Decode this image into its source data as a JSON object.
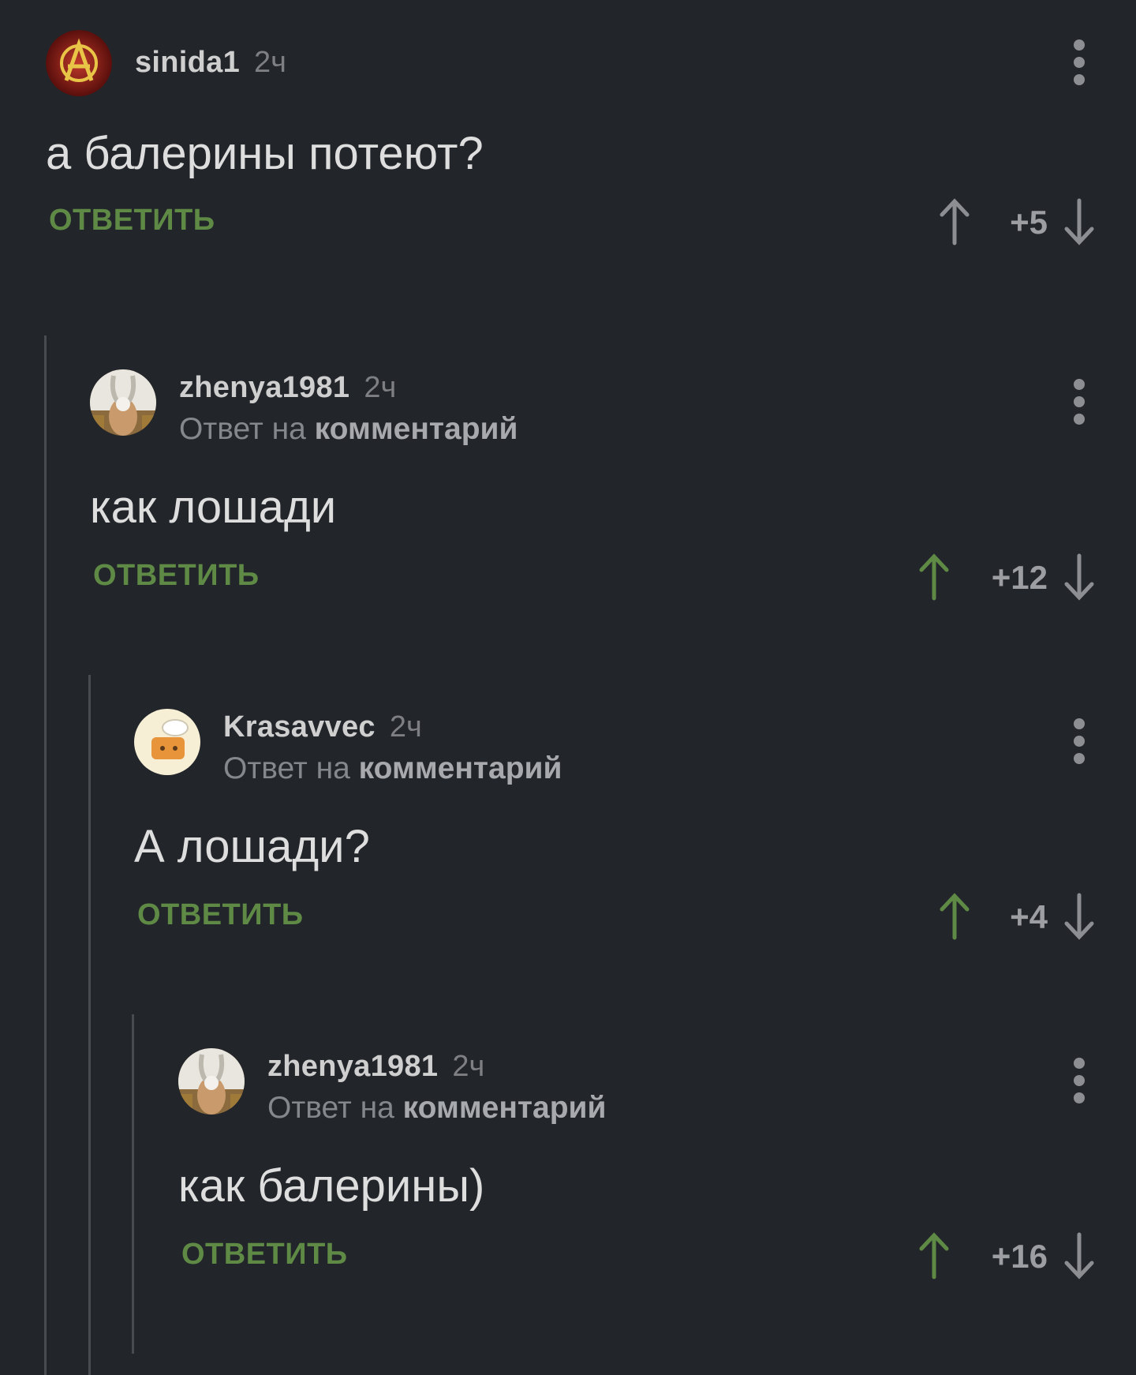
{
  "comments": [
    {
      "username": "sinida1",
      "time": "2ч",
      "avatar_icon": "anarchy-icon",
      "reply_to_prefix": "",
      "reply_to_link": "",
      "text": "а балерины потеют?",
      "reply_label": "ОТВЕТИТЬ",
      "score": "+5",
      "upvoted": false
    },
    {
      "username": "zhenya1981",
      "time": "2ч",
      "avatar_icon": "rabbit-icon",
      "reply_to_prefix": "Ответ на",
      "reply_to_link": "комментарий",
      "text": "как лошади",
      "reply_label": "ОТВЕТИТЬ",
      "score": "+12",
      "upvoted": true
    },
    {
      "username": "Krasavvec",
      "time": "2ч",
      "avatar_icon": "cartoon-face-icon",
      "reply_to_prefix": "Ответ на",
      "reply_to_link": "комментарий",
      "text": "А лошади?",
      "reply_label": "ОТВЕТИТЬ",
      "score": "+4",
      "upvoted": true
    },
    {
      "username": "zhenya1981",
      "time": "2ч",
      "avatar_icon": "rabbit-icon",
      "reply_to_prefix": "Ответ на",
      "reply_to_link": "комментарий",
      "text": "как балерины)",
      "reply_label": "ОТВЕТИТЬ",
      "score": "+16",
      "upvoted": true
    }
  ],
  "colors": {
    "background": "#22252a",
    "reply_green": "#5f8a45",
    "upvote_active": "#5f8a45",
    "vote_inactive": "#8c8e92"
  },
  "icons": {
    "more": "vertical-dots-icon",
    "upvote": "arrow-up-icon",
    "downvote": "arrow-down-icon"
  }
}
